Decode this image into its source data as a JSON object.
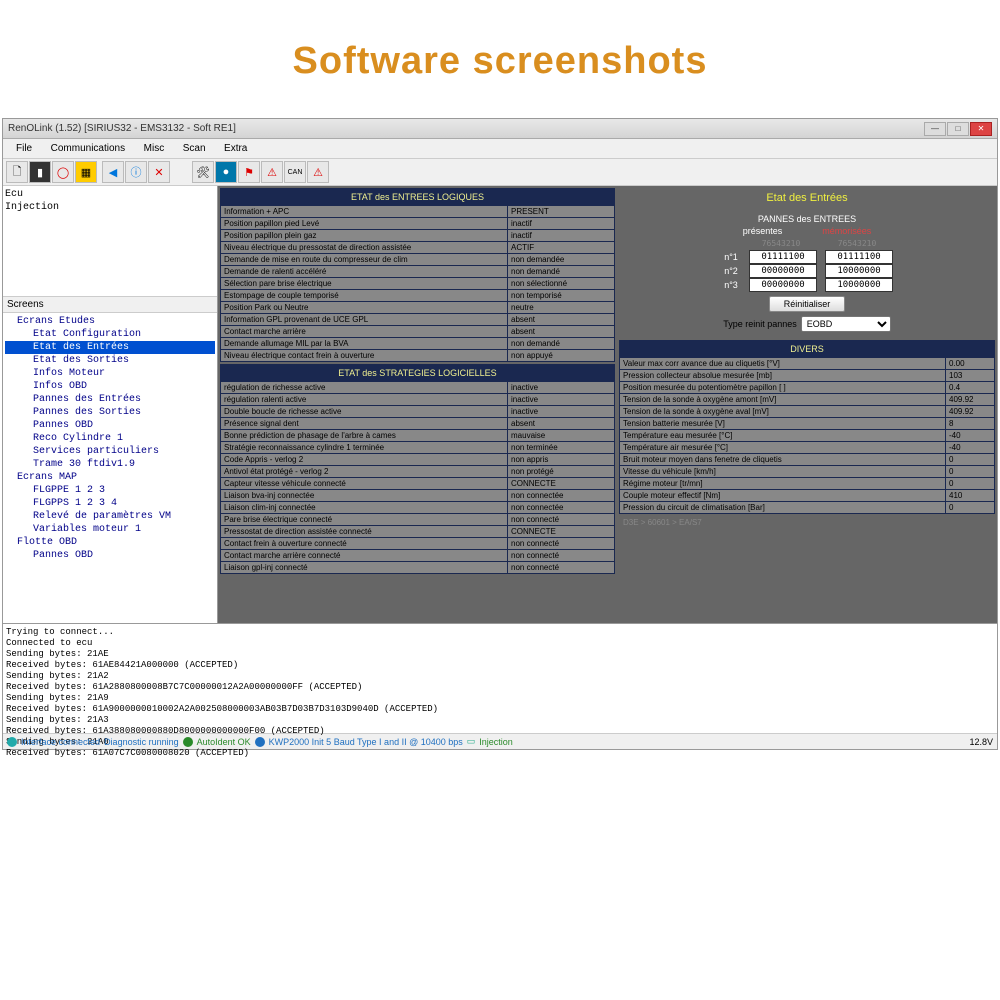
{
  "page_title": "Software screenshots",
  "window_title": "RenOLink (1.52) [SIRIUS32 - EMS3132 - Soft RE1]",
  "menu": [
    "File",
    "Communications",
    "Misc",
    "Scan",
    "Extra"
  ],
  "left_upper": [
    "Ecu",
    "Injection"
  ],
  "left_label": "Screens",
  "tree": [
    {
      "text": "Ecrans Etudes",
      "indent": 1,
      "sel": false
    },
    {
      "text": "Etat Configuration",
      "indent": 2,
      "sel": false
    },
    {
      "text": "Etat des Entrées",
      "indent": 2,
      "sel": true
    },
    {
      "text": "Etat des Sorties",
      "indent": 2,
      "sel": false
    },
    {
      "text": "Infos Moteur",
      "indent": 2,
      "sel": false
    },
    {
      "text": "Infos OBD",
      "indent": 2,
      "sel": false
    },
    {
      "text": "Pannes des Entrées",
      "indent": 2,
      "sel": false
    },
    {
      "text": "Pannes des Sorties",
      "indent": 2,
      "sel": false
    },
    {
      "text": "Pannes OBD",
      "indent": 2,
      "sel": false
    },
    {
      "text": "Reco Cylindre 1",
      "indent": 2,
      "sel": false
    },
    {
      "text": "Services particuliers",
      "indent": 2,
      "sel": false
    },
    {
      "text": "Trame 30 ftdiv1.9",
      "indent": 2,
      "sel": false
    },
    {
      "text": "Ecrans MAP",
      "indent": 1,
      "sel": false
    },
    {
      "text": "FLGPPE 1 2 3",
      "indent": 2,
      "sel": false
    },
    {
      "text": "FLGPPS 1 2 3 4",
      "indent": 2,
      "sel": false
    },
    {
      "text": "Relevé de paramètres VM",
      "indent": 2,
      "sel": false
    },
    {
      "text": "Variables moteur 1",
      "indent": 2,
      "sel": false
    },
    {
      "text": "Flotte OBD",
      "indent": 1,
      "sel": false
    },
    {
      "text": "Pannes OBD",
      "indent": 2,
      "sel": false
    }
  ],
  "table1_header": "ETAT des ENTREES LOGIQUES",
  "table1": [
    {
      "l": "Information + APC",
      "v": "PRESENT"
    },
    {
      "l": "Position papillon pied Levé",
      "v": "inactif"
    },
    {
      "l": "Position papillon plein gaz",
      "v": "inactif"
    },
    {
      "l": "Niveau électrique du pressostat de direction assistée",
      "v": "ACTIF"
    },
    {
      "l": "Demande de mise en route du compresseur de clim",
      "v": "non demandée"
    },
    {
      "l": "Demande de ralenti accéléré",
      "v": "non demandé"
    },
    {
      "l": "Sélection pare brise électrique",
      "v": "non sélectionné"
    },
    {
      "l": "Estompage de couple temporisé",
      "v": "non temporisé"
    },
    {
      "l": "Position Park ou Neutre",
      "v": "neutre"
    },
    {
      "l": "Information GPL provenant de UCE GPL",
      "v": "absent"
    },
    {
      "l": "Contact marche arrière",
      "v": "absent"
    },
    {
      "l": "Demande allumage MIL par la BVA",
      "v": "non demandé"
    },
    {
      "l": "Niveau électrique contact frein à ouverture",
      "v": "non appuyé"
    }
  ],
  "table2_header": "ETAT des STRATEGIES LOGICIELLES",
  "table2": [
    {
      "l": "régulation de richesse active",
      "v": "inactive"
    },
    {
      "l": "régulation ralenti active",
      "v": "inactive"
    },
    {
      "l": "Double boucle de richesse active",
      "v": "inactive"
    },
    {
      "l": "Présence signal dent",
      "v": "absent"
    },
    {
      "l": "Bonne prédiction de phasage de l'arbre à cames",
      "v": "mauvaise"
    },
    {
      "l": "Stratégie reconnaissance cylindre 1 terminée",
      "v": "non terminée"
    },
    {
      "l": "Code Appris - verlog 2",
      "v": "non appris"
    },
    {
      "l": "Antivol état protégé - verlog 2",
      "v": "non protégé"
    },
    {
      "l": "Capteur vitesse véhicule connecté",
      "v": "CONNECTE"
    },
    {
      "l": "Liaison bva-inj connectée",
      "v": "non connectée"
    },
    {
      "l": "Liaison clim-inj connectée",
      "v": "non connectée"
    },
    {
      "l": "Pare brise électrique connecté",
      "v": "non connecté"
    },
    {
      "l": "Pressostat de direction assistée connecté",
      "v": "CONNECTE"
    },
    {
      "l": "Contact frein à ouverture connecté",
      "v": "non connecté"
    },
    {
      "l": "Contact marche arrière connecté",
      "v": "non connecté"
    },
    {
      "l": "Liaison gpl-inj connecté",
      "v": "non connecté"
    }
  ],
  "right_title": "Etat des Entrées",
  "pannes_header": "PANNES des ENTREES",
  "pannes_presentes": "présentes",
  "pannes_memorisees": "mémorisées",
  "bin_head": "76543210",
  "bin_rows": [
    {
      "n": "n°1",
      "a": "01111100",
      "b": "01111100"
    },
    {
      "n": "n°2",
      "a": "00000000",
      "b": "10000000"
    },
    {
      "n": "n°3",
      "a": "00000000",
      "b": "10000000"
    }
  ],
  "btn_reset": "Réinitialiser",
  "type_label": "Type reinit pannes",
  "type_value": "EOBD",
  "divers_header": "DIVERS",
  "divers": [
    {
      "l": "Valeur max corr avance due au cliquetis [°V]",
      "v": "0.00"
    },
    {
      "l": "Pression collecteur absolue mesurée [mb]",
      "v": "103"
    },
    {
      "l": "Position mesurée du potentiomètre papillon [ ]",
      "v": "0.4"
    },
    {
      "l": "Tension de la sonde à oxygène amont [mV]",
      "v": "409.92"
    },
    {
      "l": "Tension de la sonde à oxygène aval [mV]",
      "v": "409.92"
    },
    {
      "l": "Tension batterie mesurée [V]",
      "v": "8"
    },
    {
      "l": "Température eau mesurée [°C]",
      "v": "-40"
    },
    {
      "l": "Température air mesurée [°C]",
      "v": "-40"
    },
    {
      "l": "Bruit moteur moyen dans fenetre de cliquetis",
      "v": "0"
    },
    {
      "l": "Vitesse du véhicule [km/h]",
      "v": "0"
    },
    {
      "l": "Régime moteur [tr/mn]",
      "v": "0"
    },
    {
      "l": "Couple moteur effectif [Nm]",
      "v": "410"
    },
    {
      "l": "Pression du circuit de climatisation [Bar]",
      "v": "0"
    }
  ],
  "divers_footer": "D3E > 60601 > EA/S7",
  "log": "Trying to connect...\nConnected to ecu\nSending bytes: 21AE\nReceived bytes: 61AE84421A000000 (ACCEPTED)\nSending bytes: 21A2\nReceived bytes: 61A2880800008B7C7C00000012A2A00000000FF (ACCEPTED)\nSending bytes: 21A9\nReceived bytes: 61A9000000010002A2A002508000003AB03B7D03B7D3103D9040D (ACCEPTED)\nSending bytes: 21A3\nReceived bytes: 61A388080000880D8000000000000F00 (ACCEPTED)\nSending bytes: 21A0\nReceived bytes: 61A07C7C0080008020 (ACCEPTED)",
  "status": {
    "interface": "Interface connected",
    "diag": "Diagnostic running",
    "auto": "AutoIdent OK",
    "kwp": "KWP2000 Init 5 Baud Type I and II @ 10400 bps",
    "inj": "Injection",
    "voltage": "12.8V"
  }
}
